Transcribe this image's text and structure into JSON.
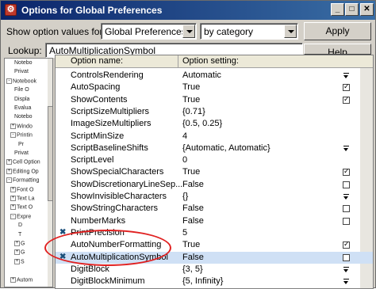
{
  "window": {
    "title": "Options for Global Preferences",
    "minimize_label": "_",
    "maximize_label": "□",
    "close_label": "✕"
  },
  "toolbar": {
    "show_label": "Show option values for:",
    "scope_value": "Global Preferences",
    "grouping_value": "by category",
    "apply_label": "Apply",
    "lookup_label": "Lookup:",
    "lookup_value": "AutoMultiplicationSymbol",
    "help_label": "Help"
  },
  "grid": {
    "col_name": "Option name:",
    "col_setting": "Option setting:",
    "rows": [
      {
        "name": "ControlsRendering",
        "value": "Automatic",
        "mark": "",
        "control": "dropdown"
      },
      {
        "name": "AutoSpacing",
        "value": "True",
        "mark": "",
        "control": "checked"
      },
      {
        "name": "ShowContents",
        "value": "True",
        "mark": "",
        "control": "checked"
      },
      {
        "name": "ScriptSizeMultipliers",
        "value": "{0.71}",
        "mark": "",
        "control": "none"
      },
      {
        "name": "ImageSizeMultipliers",
        "value": "{0.5, 0.25}",
        "mark": "",
        "control": "none"
      },
      {
        "name": "ScriptMinSize",
        "value": "4",
        "mark": "",
        "control": "none"
      },
      {
        "name": "ScriptBaselineShifts",
        "value": "{Automatic, Automatic}",
        "mark": "",
        "control": "dropdown"
      },
      {
        "name": "ScriptLevel",
        "value": "0",
        "mark": "",
        "control": "none"
      },
      {
        "name": "ShowSpecialCharacters",
        "value": "True",
        "mark": "",
        "control": "checked"
      },
      {
        "name": "ShowDiscretionaryLineSep...",
        "value": "False",
        "mark": "",
        "control": "unchecked"
      },
      {
        "name": "ShowInvisibleCharacters",
        "value": "{}",
        "mark": "",
        "control": "dropdown"
      },
      {
        "name": "ShowStringCharacters",
        "value": "False",
        "mark": "",
        "control": "unchecked"
      },
      {
        "name": "NumberMarks",
        "value": "False",
        "mark": "",
        "control": "unchecked"
      },
      {
        "name": "PrintPrecision",
        "value": "5",
        "mark": "✖",
        "control": "none"
      },
      {
        "name": "AutoNumberFormatting",
        "value": "True",
        "mark": "",
        "control": "checked"
      },
      {
        "name": "AutoMultiplicationSymbol",
        "value": "False",
        "mark": "✖",
        "control": "unchecked"
      },
      {
        "name": "DigitBlock",
        "value": "{3, 5}",
        "mark": "",
        "control": "dropdown"
      },
      {
        "name": "DigitBlockMinimum",
        "value": "{5, Infinity}",
        "mark": "",
        "control": "dropdown"
      },
      {
        "name": "NumberPoint",
        "value": "\".\"",
        "mark": "",
        "control": "none"
      }
    ]
  },
  "tree": {
    "items": [
      {
        "label": "Notebo",
        "indent": 2,
        "box": ""
      },
      {
        "label": "Privat",
        "indent": 2,
        "box": ""
      },
      {
        "label": "Notebook",
        "indent": 0,
        "box": "-"
      },
      {
        "label": "File O",
        "indent": 2,
        "box": ""
      },
      {
        "label": "Displa",
        "indent": 2,
        "box": ""
      },
      {
        "label": "Evalua",
        "indent": 2,
        "box": ""
      },
      {
        "label": "Notebo",
        "indent": 2,
        "box": ""
      },
      {
        "label": "Windo",
        "indent": 1,
        "box": "+"
      },
      {
        "label": "Printin",
        "indent": 1,
        "box": "-"
      },
      {
        "label": "Pr",
        "indent": 3,
        "box": ""
      },
      {
        "label": "Privat",
        "indent": 2,
        "box": ""
      },
      {
        "label": "Cell Option",
        "indent": 0,
        "box": "+"
      },
      {
        "label": "Editing Op",
        "indent": 0,
        "box": "+"
      },
      {
        "label": "Formatting",
        "indent": 0,
        "box": "-"
      },
      {
        "label": "Font O",
        "indent": 1,
        "box": "+"
      },
      {
        "label": "Text La",
        "indent": 1,
        "box": "+"
      },
      {
        "label": "Text O",
        "indent": 1,
        "box": "+"
      },
      {
        "label": "Expre",
        "indent": 1,
        "box": "-"
      },
      {
        "label": "D",
        "indent": 3,
        "box": ""
      },
      {
        "label": "T",
        "indent": 3,
        "box": ""
      },
      {
        "label": "G",
        "indent": 2,
        "box": "+"
      },
      {
        "label": "G",
        "indent": 2,
        "box": "+"
      },
      {
        "label": "S",
        "indent": 2,
        "box": "+"
      },
      {
        "label": "",
        "indent": 2,
        "box": ""
      },
      {
        "label": "Autom",
        "indent": 1,
        "box": "+"
      }
    ]
  }
}
